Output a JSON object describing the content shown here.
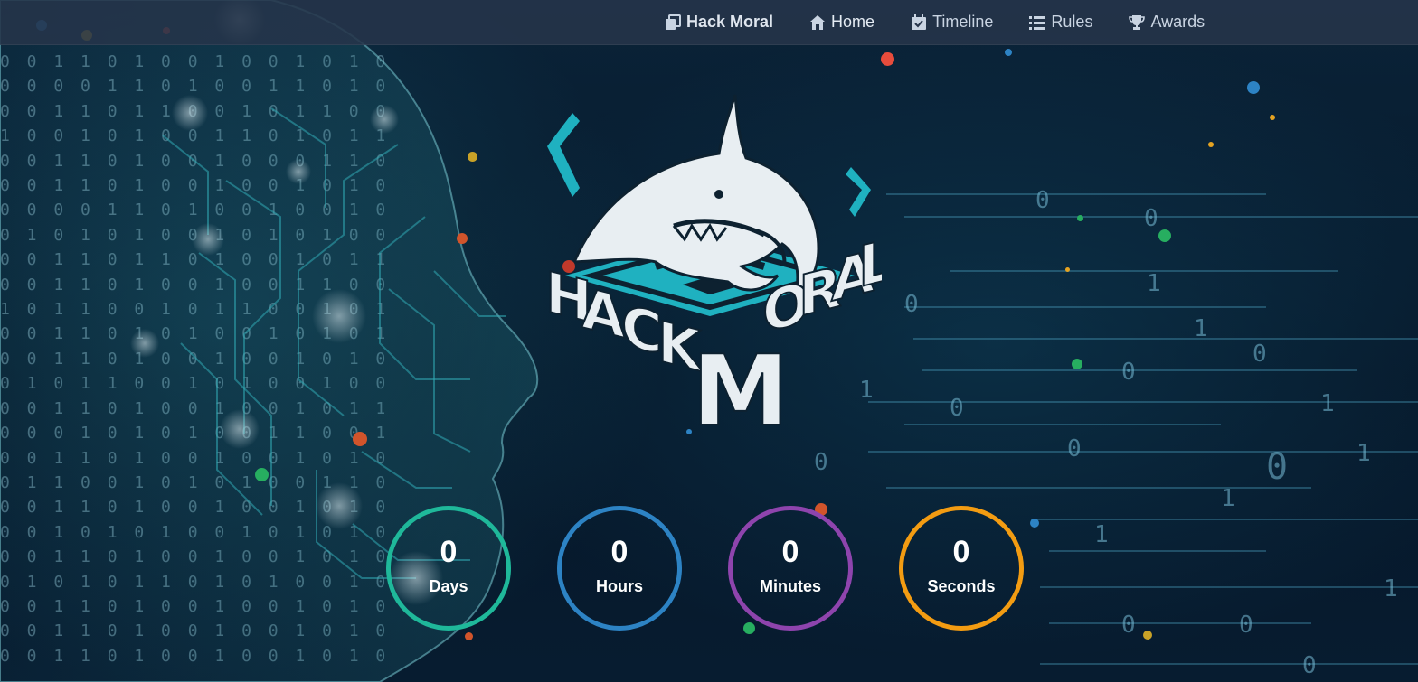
{
  "nav": {
    "brand": "Hack Moral",
    "items": [
      {
        "label": "Home",
        "icon": "home-icon"
      },
      {
        "label": "Timeline",
        "icon": "calendar-check-icon"
      },
      {
        "label": "Rules",
        "icon": "list-icon"
      },
      {
        "label": "Awards",
        "icon": "trophy-icon"
      }
    ]
  },
  "logo": {
    "text": "HACKMORAL",
    "colors": {
      "teal": "#1fb1c0",
      "white": "#e8eef2",
      "dark": "#0d2130"
    }
  },
  "countdown": {
    "days": {
      "value": "0",
      "label": "Days",
      "color": "#1fb89a"
    },
    "hours": {
      "value": "0",
      "label": "Hours",
      "color": "#2d83c4"
    },
    "minutes": {
      "value": "0",
      "label": "Minutes",
      "color": "#8e44ad"
    },
    "seconds": {
      "value": "0",
      "label": "Seconds",
      "color": "#f39c12"
    }
  }
}
